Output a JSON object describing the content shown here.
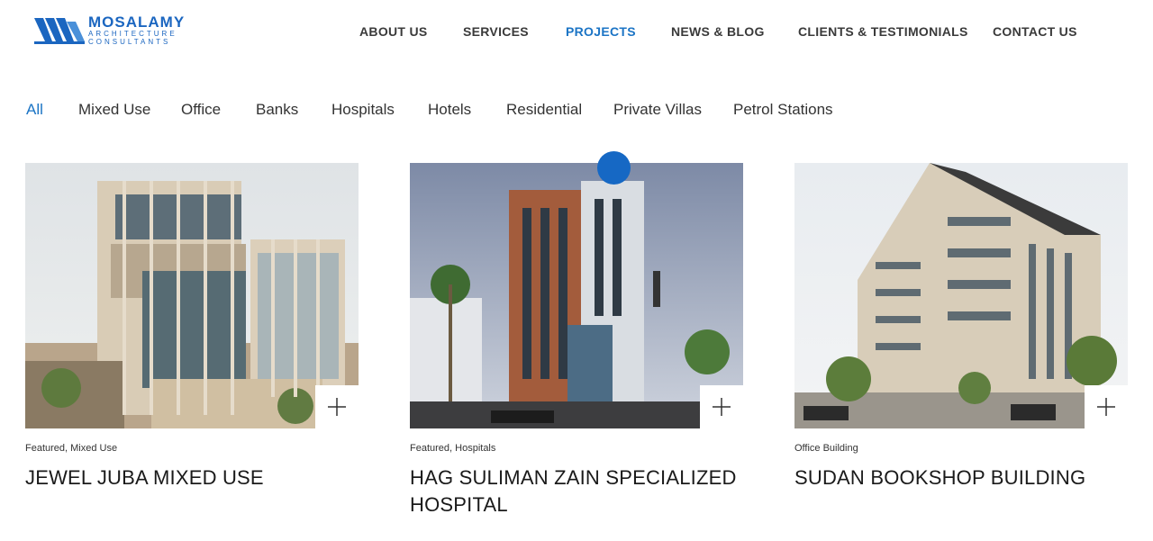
{
  "logo": {
    "name": "MOSALAMY",
    "subtitle_line1": "ARCHITECTURE",
    "subtitle_line2": "CONSULTANTS"
  },
  "nav": {
    "items": [
      {
        "label": "ABOUT US",
        "active": false
      },
      {
        "label": "SERVICES",
        "active": false
      },
      {
        "label": "PROJECTS",
        "active": true
      },
      {
        "label": "NEWS & BLOG",
        "active": false
      },
      {
        "label": "CLIENTS & TESTIMONIALS",
        "active": false
      },
      {
        "label": "CONTACT US",
        "active": false
      }
    ]
  },
  "filters": [
    {
      "label": "All",
      "active": true
    },
    {
      "label": "Mixed Use",
      "active": false
    },
    {
      "label": "Office",
      "active": false
    },
    {
      "label": "Banks",
      "active": false
    },
    {
      "label": "Hospitals",
      "active": false
    },
    {
      "label": "Hotels",
      "active": false
    },
    {
      "label": "Residential",
      "active": false
    },
    {
      "label": "Private Villas",
      "active": false
    },
    {
      "label": "Petrol Stations",
      "active": false
    }
  ],
  "projects": [
    {
      "tags": "Featured,  Mixed Use",
      "title": "JEWEL JUBA MIXED USE",
      "icon": "plus-icon"
    },
    {
      "tags": "Featured,  Hospitals",
      "title": "HAG SULIMAN ZAIN SPECIALIZED HOSPITAL",
      "icon": "plus-icon"
    },
    {
      "tags": "Office Building",
      "title": "SUDAN BOOKSHOP BUILDING",
      "icon": "plus-icon"
    }
  ],
  "colors": {
    "accent": "#1b74c5",
    "brand": "#1b66c0",
    "text": "#333333"
  }
}
